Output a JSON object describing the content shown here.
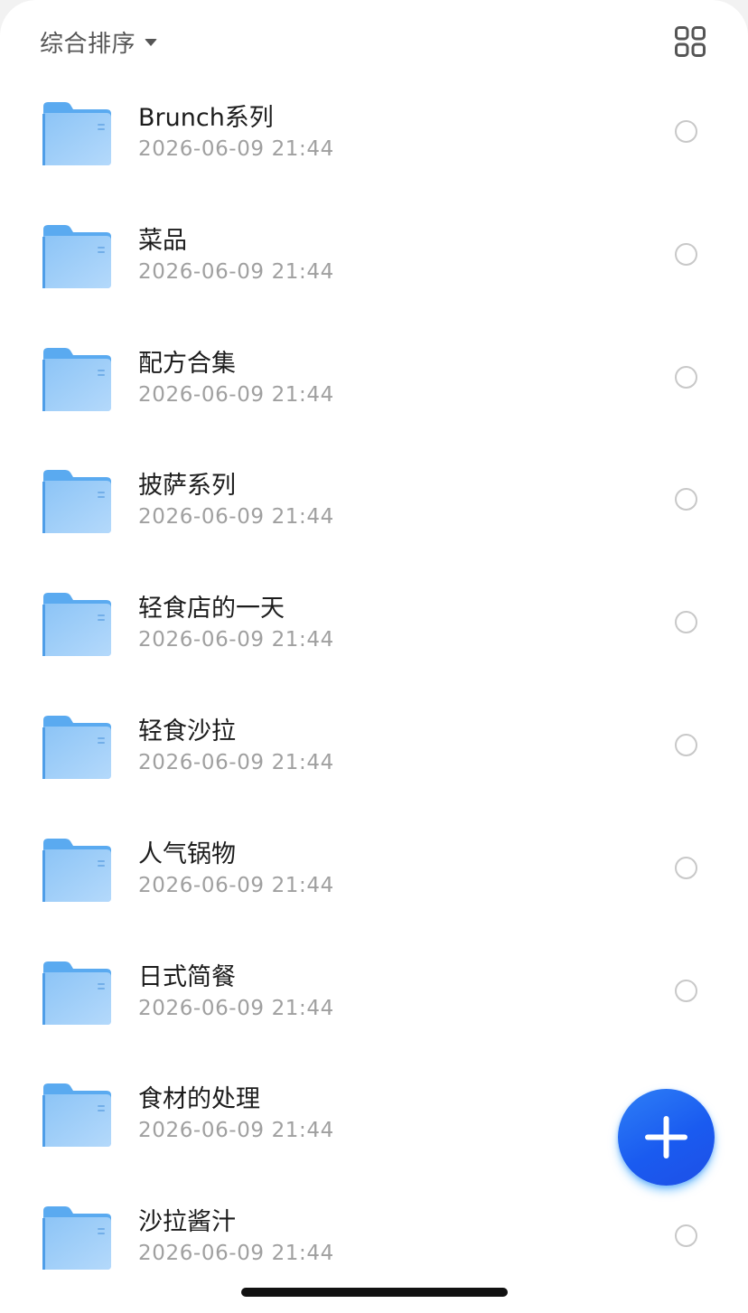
{
  "toolbar": {
    "sort_label": "综合排序",
    "sort_icon": "caret-down-icon",
    "view_toggle_icon": "grid-view-icon"
  },
  "folders": [
    {
      "name": "Brunch系列",
      "date": "2026-06-09 21:44"
    },
    {
      "name": "菜品",
      "date": "2026-06-09 21:44"
    },
    {
      "name": "配方合集",
      "date": "2026-06-09 21:44"
    },
    {
      "name": "披萨系列",
      "date": "2026-06-09 21:44"
    },
    {
      "name": "轻食店的一天",
      "date": "2026-06-09 21:44"
    },
    {
      "name": "轻食沙拉",
      "date": "2026-06-09 21:44"
    },
    {
      "name": "人气锅物",
      "date": "2026-06-09 21:44"
    },
    {
      "name": "日式简餐",
      "date": "2026-06-09 21:44"
    },
    {
      "name": "食材的处理",
      "date": "2026-06-09 21:44"
    },
    {
      "name": "沙拉酱汁",
      "date": "2026-06-09 21:44"
    }
  ],
  "fab": {
    "icon": "plus-icon",
    "color": "#1a5bf0"
  },
  "colors": {
    "folder": "#7fbef5",
    "title_text": "#1c1c1c",
    "date_text": "#a0a0a0"
  }
}
